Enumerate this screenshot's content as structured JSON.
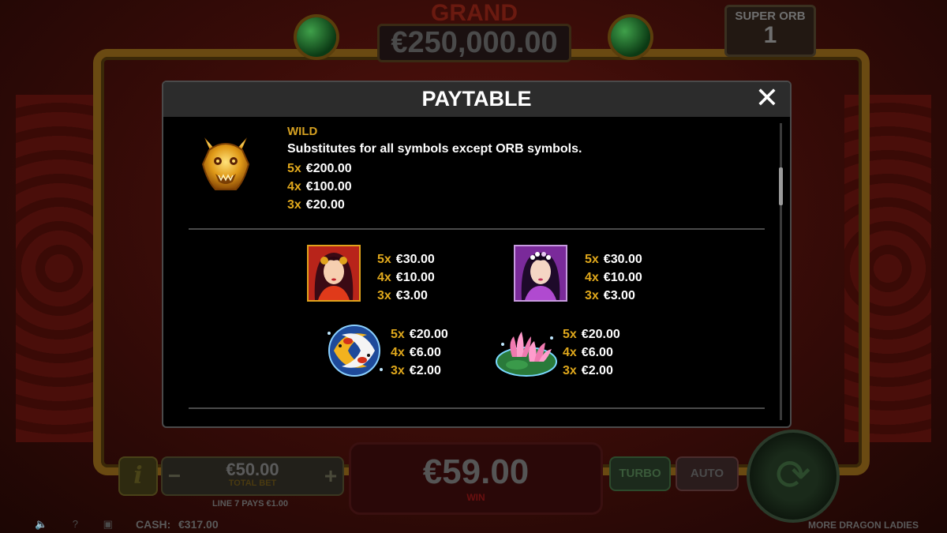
{
  "background": {
    "jackpot_label": "GRAND",
    "jackpot_value": "€250,000.00",
    "super_orb_label": "SUPER ORB",
    "super_orb_value": "1"
  },
  "controls": {
    "info_label": "i",
    "minus_label": "−",
    "plus_label": "+",
    "total_bet_value": "€50.00",
    "total_bet_label": "TOTAL BET",
    "line_pays": "LINE 7 PAYS €1.00",
    "win_value": "€59.00",
    "win_label": "WIN",
    "turbo_label": "TURBO",
    "auto_label": "AUTO",
    "spin_icon": "spin-arrows-icon"
  },
  "statusbar": {
    "icons": "🔈 ? ▣",
    "cash_label": "CASH:",
    "cash_value": "€317.00",
    "game_name": "MORE DRAGON LADIES"
  },
  "paytable": {
    "title": "PAYTABLE",
    "close_icon": "close-icon",
    "wild": {
      "title": "WILD",
      "description": "Substitutes for all symbols except ORB symbols.",
      "icon": "golden-dragon-icon",
      "pays": [
        {
          "mult": "5x",
          "amount": "€200.00"
        },
        {
          "mult": "4x",
          "amount": "€100.00"
        },
        {
          "mult": "3x",
          "amount": "€20.00"
        }
      ]
    },
    "symbols": [
      {
        "icon": "red-lady-icon",
        "pays": [
          {
            "mult": "5x",
            "amount": "€30.00"
          },
          {
            "mult": "4x",
            "amount": "€10.00"
          },
          {
            "mult": "3x",
            "amount": "€3.00"
          }
        ]
      },
      {
        "icon": "purple-lady-icon",
        "pays": [
          {
            "mult": "5x",
            "amount": "€30.00"
          },
          {
            "mult": "4x",
            "amount": "€10.00"
          },
          {
            "mult": "3x",
            "amount": "€3.00"
          }
        ]
      },
      {
        "icon": "koi-fish-icon",
        "pays": [
          {
            "mult": "5x",
            "amount": "€20.00"
          },
          {
            "mult": "4x",
            "amount": "€6.00"
          },
          {
            "mult": "3x",
            "amount": "€2.00"
          }
        ]
      },
      {
        "icon": "lotus-flower-icon",
        "pays": [
          {
            "mult": "5x",
            "amount": "€20.00"
          },
          {
            "mult": "4x",
            "amount": "€6.00"
          },
          {
            "mult": "3x",
            "amount": "€2.00"
          }
        ]
      }
    ]
  },
  "colors": {
    "accent_gold": "#e0a81c",
    "header_bg": "#2c2c2c",
    "modal_bg": "#000000"
  }
}
